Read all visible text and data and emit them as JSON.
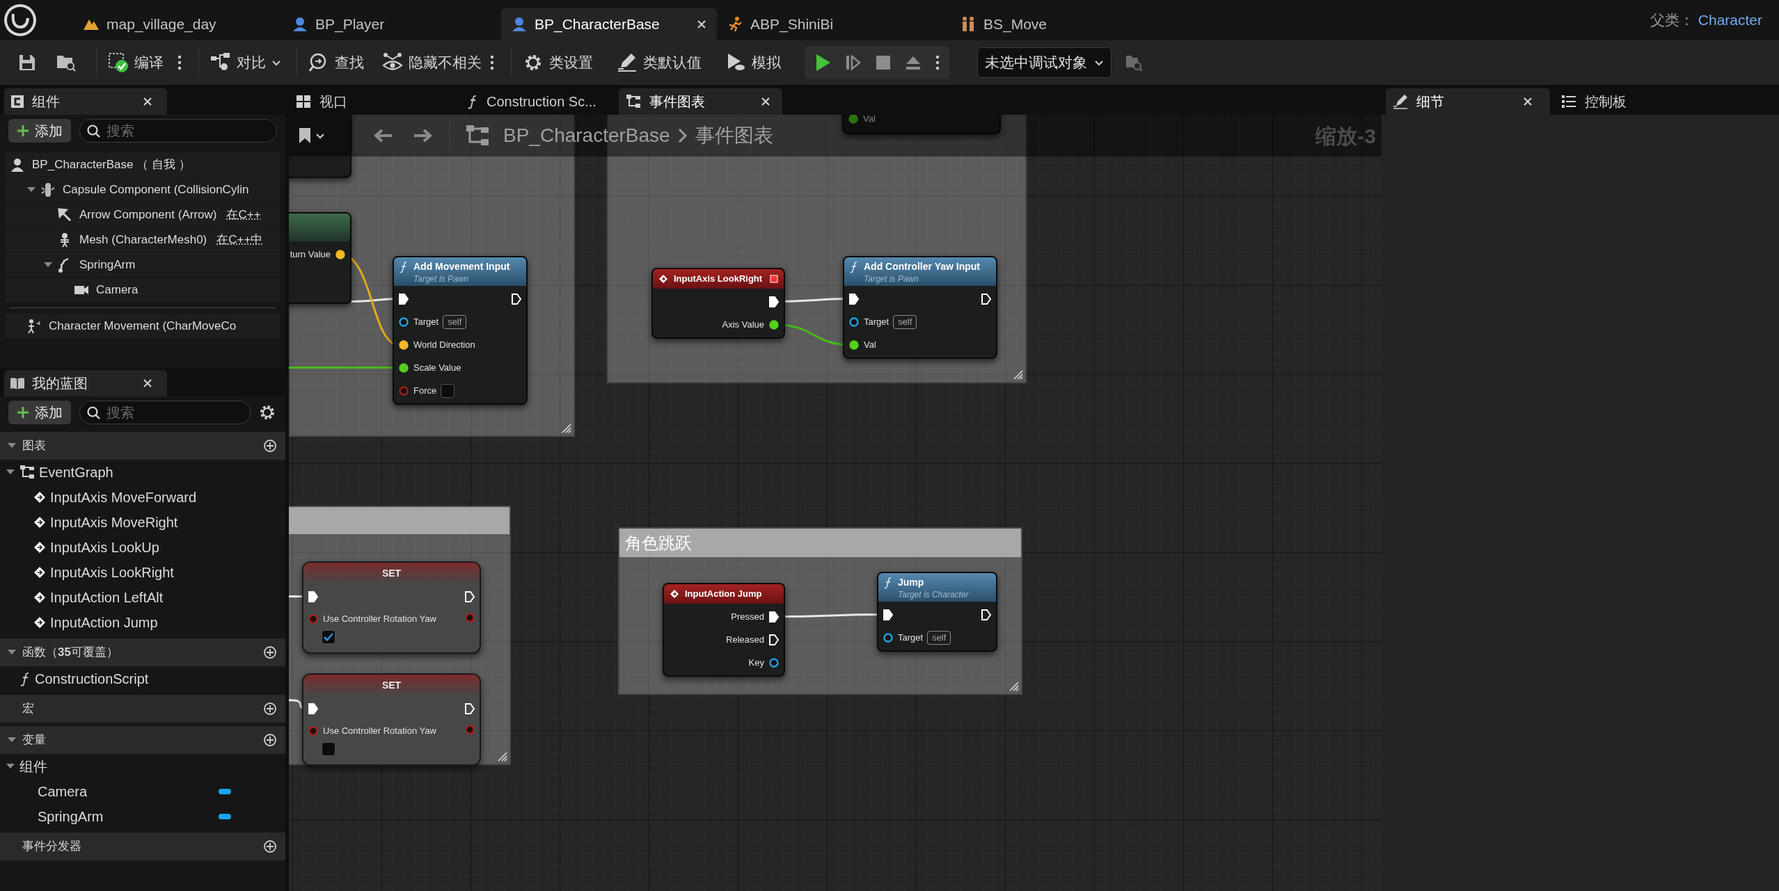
{
  "title_bar": {
    "tabs": [
      {
        "label": "map_village_day",
        "selected": false
      },
      {
        "label": "BP_Player",
        "selected": false
      },
      {
        "label": "BP_CharacterBase",
        "selected": true
      },
      {
        "label": "ABP_ShiniBi",
        "selected": false
      },
      {
        "label": "BS_Move",
        "selected": false
      }
    ],
    "parent_label": "父类：",
    "parent_class": "Character"
  },
  "toolbar": {
    "buttons": [
      {
        "label": "编译"
      },
      {
        "label": "对比"
      },
      {
        "label": "查找"
      },
      {
        "label": "隐藏不相关"
      },
      {
        "label": "类设置"
      },
      {
        "label": "类默认值"
      },
      {
        "label": "模拟"
      }
    ],
    "debug_target": "未选中调试对象"
  },
  "components_panel": {
    "title": "组件",
    "add_label": "添加",
    "search_placeholder": "搜索",
    "tree": [
      {
        "label": "BP_CharacterBase （ 自我 ）",
        "children": [
          {
            "label": "Capsule Component (CollisionCylin",
            "expanded": true,
            "children": [
              {
                "label": "Arrow Component (Arrow)",
                "note": "在C++"
              },
              {
                "label": "Mesh (CharacterMesh0)",
                "note": "在C++中"
              },
              {
                "label": "SpringArm",
                "expanded": true,
                "children": [
                  {
                    "label": "Camera"
                  }
                ]
              }
            ]
          }
        ]
      }
    ],
    "movement": {
      "label": "Character Movement (CharMoveCo"
    }
  },
  "blueprint_panel": {
    "title": "我的蓝图",
    "add_label": "添加",
    "search_placeholder": "搜索",
    "sections": [
      {
        "title": "图表",
        "expanded": true,
        "items": [
          {
            "kind": "graph",
            "label": "EventGraph",
            "expanded": true,
            "children": [
              {
                "kind": "event",
                "label": "InputAxis MoveForward"
              },
              {
                "kind": "event",
                "label": "InputAxis MoveRight"
              },
              {
                "kind": "event",
                "label": "InputAxis LookUp"
              },
              {
                "kind": "event",
                "label": "InputAxis LookRight"
              },
              {
                "kind": "event",
                "label": "InputAction LeftAlt"
              },
              {
                "kind": "event",
                "label": "InputAction Jump"
              }
            ]
          }
        ]
      },
      {
        "title": "函数（**35**可覆盖）",
        "expanded": true,
        "items": [
          {
            "kind": "function",
            "label": "ConstructionScript"
          }
        ]
      },
      {
        "title": "宏"
      },
      {
        "title": "变量",
        "expanded": true,
        "items": [
          {
            "kind": "category",
            "label": "组件",
            "expanded": true,
            "children": [
              {
                "kind": "variable",
                "label": "Camera"
              },
              {
                "kind": "variable",
                "label": "SpringArm"
              }
            ]
          }
        ]
      },
      {
        "title": "事件分发器"
      }
    ]
  },
  "graph_tabs": [
    {
      "label": "视口",
      "selected": false
    },
    {
      "label": "Construction Sc...",
      "selected": false
    },
    {
      "label": "事件图表",
      "selected": true
    }
  ],
  "breadcrumb": {
    "path": [
      "BP_CharacterBase",
      "事件图表"
    ],
    "zoom": "缩放-3"
  },
  "graph": {
    "comments": [
      {
        "title": "角色跳跃"
      }
    ],
    "nodes": [
      {
        "kind": "fragment"
      },
      {
        "kind": "fragment",
        "outputs": [
          {
            "label": "turn Value",
            "kind": "vector",
            "connected": true
          }
        ]
      },
      {
        "kind": "function",
        "title": "Add Movement Input",
        "subtitle": "Target is Pawn",
        "inputs": [
          {
            "kind": "exec",
            "connected": true
          },
          {
            "label": "Target",
            "kind": "object",
            "connected": false,
            "default": "self"
          },
          {
            "label": "World Direction",
            "kind": "vector",
            "connected": true
          },
          {
            "label": "Scale Value",
            "kind": "float",
            "connected": true
          },
          {
            "label": "Force",
            "kind": "bool",
            "connected": false,
            "checked": false
          }
        ],
        "outputs": [
          {
            "kind": "exec",
            "connected": false
          }
        ]
      },
      {
        "kind": "fragment",
        "inputs": [
          {
            "label": "Val",
            "kind": "float",
            "connected": true
          }
        ]
      },
      {
        "kind": "event",
        "title": "InputAxis LookRight",
        "outputs": [
          {
            "kind": "exec",
            "connected": true
          },
          {
            "label": "Axis Value",
            "kind": "float",
            "connected": true
          }
        ]
      },
      {
        "kind": "function",
        "title": "Add Controller Yaw Input",
        "subtitle": "Target is Pawn",
        "inputs": [
          {
            "kind": "exec",
            "connected": true
          },
          {
            "label": "Target",
            "kind": "object",
            "connected": false,
            "default": "self"
          },
          {
            "label": "Val",
            "kind": "float",
            "connected": true
          }
        ],
        "outputs": [
          {
            "kind": "exec",
            "connected": false
          }
        ]
      },
      {
        "kind": "set",
        "title": "SET",
        "inputs": [
          {
            "kind": "exec",
            "connected": true
          },
          {
            "label": "Use Controller Rotation Yaw",
            "kind": "bool",
            "connected": false,
            "checked": true
          }
        ],
        "outputs": [
          {
            "kind": "exec",
            "connected": false
          },
          {
            "kind": "bool",
            "connected": false
          }
        ]
      },
      {
        "kind": "set",
        "title": "SET",
        "inputs": [
          {
            "kind": "exec",
            "connected": true
          },
          {
            "label": "Use Controller Rotation Yaw",
            "kind": "bool",
            "connected": false,
            "checked": false
          }
        ],
        "outputs": [
          {
            "kind": "exec",
            "connected": false
          },
          {
            "kind": "bool",
            "connected": false
          }
        ]
      },
      {
        "kind": "event",
        "title": "InputAction Jump",
        "outputs": [
          {
            "label": "Pressed",
            "kind": "exec",
            "connected": true
          },
          {
            "label": "Released",
            "kind": "exec",
            "connected": false
          },
          {
            "label": "Key",
            "kind": "object",
            "connected": false
          }
        ]
      },
      {
        "kind": "function",
        "title": "Jump",
        "subtitle": "Target is Character",
        "inputs": [
          {
            "kind": "exec",
            "connected": true
          },
          {
            "label": "Target",
            "kind": "object",
            "connected": false,
            "default": "self"
          }
        ],
        "outputs": [
          {
            "kind": "exec",
            "connected": false
          }
        ]
      }
    ]
  },
  "right_panel": {
    "tabs": [
      {
        "label": "细节",
        "selected": true
      },
      {
        "label": "控制板",
        "selected": false
      }
    ]
  }
}
